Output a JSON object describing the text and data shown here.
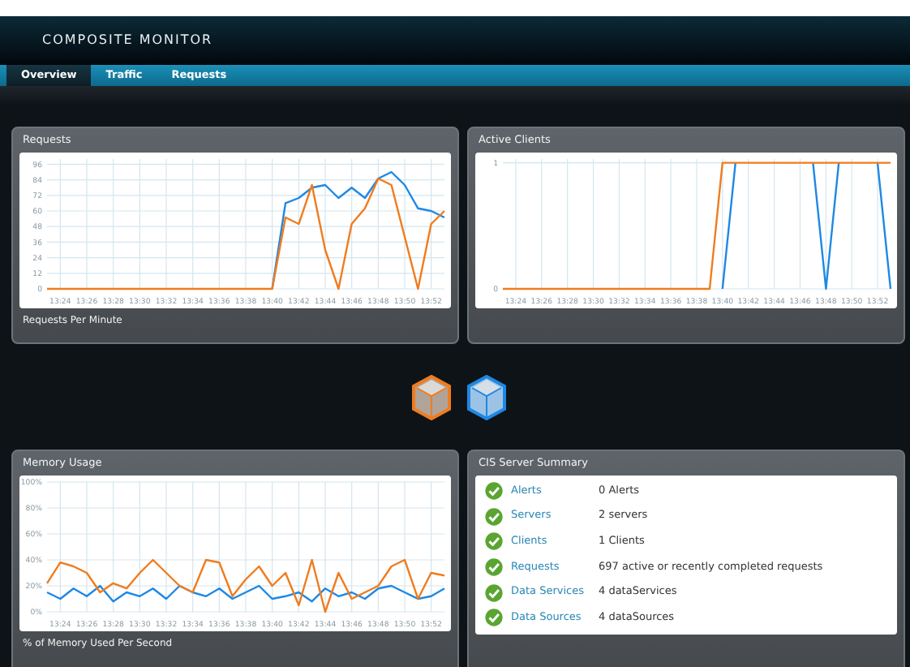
{
  "window": {
    "title": "COMPOSITE MONITOR"
  },
  "tabs": [
    {
      "label": "Overview",
      "selected": true
    },
    {
      "label": "Traffic",
      "selected": false
    },
    {
      "label": "Requests",
      "selected": false
    }
  ],
  "panels": [
    {
      "title": "Requests",
      "footer": "Requests Per Minute",
      "chart_data": {
        "type": "line",
        "categories": [
          null,
          "13:24",
          null,
          "13:26",
          null,
          "13:28",
          null,
          "13:30",
          null,
          "13:32",
          null,
          "13:34",
          null,
          "13:36",
          null,
          "13:38",
          null,
          "13:40",
          null,
          "13:42",
          null,
          "13:44",
          null,
          "13:46",
          null,
          "13:48",
          null,
          "13:50",
          null,
          "13:52",
          null
        ],
        "grid": true,
        "ylim": [
          0,
          100
        ],
        "yticks": [
          0,
          12,
          24,
          36,
          48,
          60,
          72,
          84,
          96
        ],
        "series": [
          {
            "color": "#1e88e5",
            "values": [
              null,
              null,
              null,
              null,
              null,
              null,
              null,
              null,
              null,
              null,
              null,
              null,
              null,
              null,
              null,
              null,
              null,
              0,
              66,
              70,
              78,
              80,
              70,
              78,
              70,
              85,
              90,
              80,
              62,
              60,
              55
            ]
          },
          {
            "color": "#f07c1e",
            "values": [
              0,
              0,
              0,
              0,
              0,
              0,
              0,
              0,
              0,
              0,
              0,
              0,
              0,
              0,
              0,
              0,
              0,
              0,
              55,
              50,
              80,
              30,
              0,
              50,
              62,
              85,
              80,
              40,
              0,
              50,
              60
            ]
          }
        ]
      }
    },
    {
      "title": "Active Clients",
      "chart_data": {
        "type": "line",
        "categories": [
          null,
          "13:24",
          null,
          "13:26",
          null,
          "13:28",
          null,
          "13:30",
          null,
          "13:32",
          null,
          "13:34",
          null,
          "13:36",
          null,
          "13:38",
          null,
          "13:40",
          null,
          "13:42",
          null,
          "13:44",
          null,
          "13:46",
          null,
          "13:48",
          null,
          "13:50",
          null,
          "13:52",
          null
        ],
        "grid": true,
        "ylim": [
          0,
          1.03
        ],
        "yticks": [
          0,
          1
        ],
        "series": [
          {
            "color": "#1e88e5",
            "values": [
              null,
              null,
              null,
              null,
              null,
              null,
              null,
              null,
              null,
              null,
              null,
              null,
              null,
              null,
              null,
              null,
              null,
              0,
              1,
              null,
              null,
              null,
              null,
              null,
              1,
              0,
              1,
              null,
              null,
              1,
              0
            ]
          },
          {
            "color": "#f07c1e",
            "values": [
              0,
              0,
              0,
              0,
              0,
              0,
              0,
              0,
              0,
              0,
              0,
              0,
              0,
              0,
              0,
              0,
              0,
              1,
              1,
              1,
              1,
              1,
              1,
              1,
              1,
              1,
              1,
              1,
              1,
              1,
              1
            ]
          }
        ]
      }
    },
    {
      "title": "Memory Usage",
      "footer": "% of Memory Used Per Second",
      "chart_data": {
        "type": "line",
        "categories": [
          null,
          "13:24",
          null,
          "13:26",
          null,
          "13:28",
          null,
          "13:30",
          null,
          "13:32",
          null,
          "13:34",
          null,
          "13:36",
          null,
          "13:38",
          null,
          "13:40",
          null,
          "13:42",
          null,
          "13:44",
          null,
          "13:46",
          null,
          "13:48",
          null,
          "13:50",
          null,
          "13:52",
          null
        ],
        "grid": true,
        "ylim": [
          0,
          100
        ],
        "yticks": [
          {
            "value": 0,
            "label": "0%"
          },
          {
            "value": 20,
            "label": "20%"
          },
          {
            "value": 40,
            "label": "40%"
          },
          {
            "value": 60,
            "label": "60%"
          },
          {
            "value": 80,
            "label": "80%"
          },
          {
            "value": 100,
            "label": "100%"
          }
        ],
        "series": [
          {
            "color": "#1e88e5",
            "values": [
              15,
              10,
              18,
              12,
              20,
              8,
              15,
              12,
              18,
              10,
              20,
              15,
              12,
              18,
              10,
              15,
              20,
              10,
              12,
              15,
              8,
              18,
              12,
              15,
              10,
              18,
              20,
              15,
              10,
              12,
              18
            ]
          },
          {
            "color": "#f07c1e",
            "values": [
              22,
              38,
              35,
              30,
              15,
              22,
              18,
              30,
              40,
              30,
              20,
              15,
              40,
              38,
              12,
              25,
              35,
              20,
              30,
              5,
              40,
              0,
              30,
              10,
              15,
              20,
              35,
              40,
              10,
              30,
              28
            ]
          }
        ]
      }
    }
  ],
  "summary": {
    "title": "CIS Server Summary",
    "rows": [
      {
        "label": "Alerts",
        "value": "0 Alerts"
      },
      {
        "label": "Servers",
        "value": "2 servers"
      },
      {
        "label": "Clients",
        "value": "1 Clients"
      },
      {
        "label": "Requests",
        "value": "697 active or recently completed requests"
      },
      {
        "label": "Data Services",
        "value": "4 dataServices"
      },
      {
        "label": "Data Sources",
        "value": "4 dataSources"
      }
    ]
  }
}
